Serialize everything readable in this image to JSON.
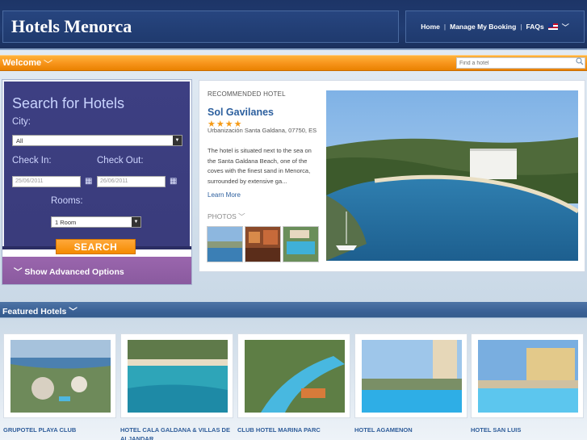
{
  "header": {
    "logo": "Hotels Menorca",
    "nav": {
      "home": "Home",
      "manage": "Manage My Booking",
      "faqs": "FAQs",
      "separator": "|"
    }
  },
  "welcome": {
    "label": "Welcome",
    "search_placeholder": "Find a hotel"
  },
  "search": {
    "title": "Search for Hotels",
    "city_label": "City:",
    "city_value": "All",
    "checkin_label": "Check In:",
    "checkout_label": "Check Out:",
    "checkin_value": "25/06/2011",
    "checkout_value": "26/06/2011",
    "rooms_label": "Rooms:",
    "rooms_value": "1 Room",
    "button": "SEARCH",
    "advanced": "Show Advanced Options"
  },
  "recommended": {
    "label": "RECOMMENDED HOTEL",
    "name": "Sol Gavilanes",
    "stars": "★★★★",
    "address": "Urbanización Santa Galdana, 07750, ES",
    "description": "The hotel is situated next to the sea on the Santa Galdana Beach, one of the coves with the finest sand in Menorca, surrounded by extensive ga...",
    "learn_more": "Learn More",
    "photos_label": "PHOTOS"
  },
  "featured": {
    "label": "Featured Hotels",
    "hotels": [
      {
        "name": "GRUPOTEL PLAYA CLUB"
      },
      {
        "name": "HOTEL CALA GALDANA & VILLAS DE ALJANDAR"
      },
      {
        "name": "CLUB HOTEL MARINA PARC"
      },
      {
        "name": "HOTEL AGAMENON"
      },
      {
        "name": "HOTEL SAN LUIS"
      }
    ]
  }
}
